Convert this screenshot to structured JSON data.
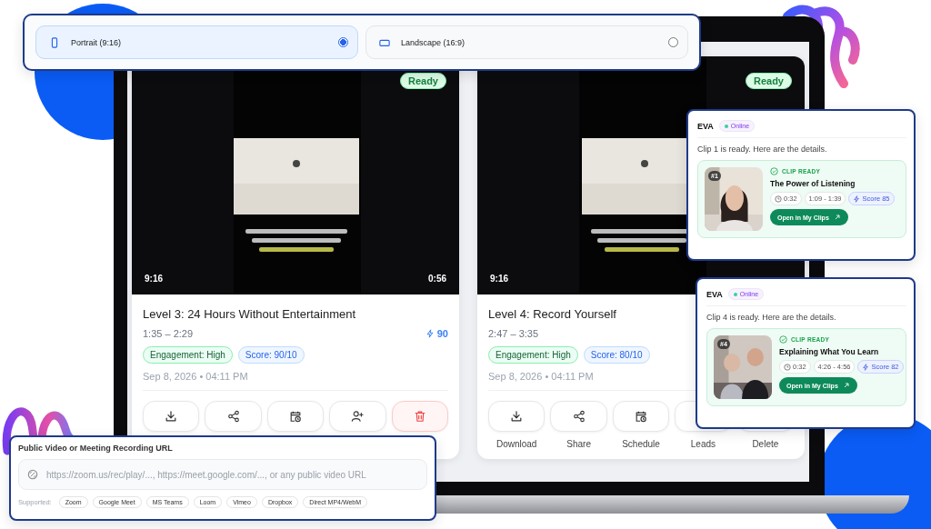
{
  "orientation_picker": {
    "options": [
      {
        "kind": "portrait",
        "label": "Portrait (9:16)",
        "selected": true
      },
      {
        "kind": "landscape",
        "label": "Landscape (16:9)",
        "selected": false
      }
    ]
  },
  "clips": [
    {
      "status": "Ready",
      "aspect": "9:16",
      "duration": "0:56",
      "title": "Level 3: 24 Hours Without Entertainment",
      "range": "1:35 – 2:29",
      "score": "90",
      "tags": [
        {
          "kind": "engagement",
          "label": "Engagement: High"
        },
        {
          "kind": "score",
          "label": "Score: 90/10"
        }
      ],
      "date": "Sep 8, 2026 • 04:11 PM",
      "actions": [
        {
          "kind": "download"
        },
        {
          "kind": "share"
        },
        {
          "kind": "schedule"
        },
        {
          "kind": "leads"
        },
        {
          "kind": "delete"
        }
      ]
    },
    {
      "status": "Ready",
      "aspect": "9:16",
      "title": "Level 4: Record Yourself",
      "range": "2:47 – 3:35",
      "tags": [
        {
          "kind": "engagement",
          "label": "Engagement: High"
        },
        {
          "kind": "score",
          "label": "Score: 80/10"
        }
      ],
      "date": "Sep 8, 2026 • 04:11 PM",
      "actions": [
        {
          "kind": "download",
          "label": "Download"
        },
        {
          "kind": "share",
          "label": "Share"
        },
        {
          "kind": "schedule",
          "label": "Schedule"
        },
        {
          "label": "Leads"
        },
        {
          "label": "Delete"
        }
      ]
    }
  ],
  "eva_messages": [
    {
      "name": "EVA",
      "status": "Online",
      "message": "Clip 1 is ready. Here are the details.",
      "clip": {
        "badge": "#1",
        "state": "CLIP READY",
        "title": "The Power of Listening",
        "duration": "0:32",
        "range": "1:09 - 1:39",
        "score": "Score 85",
        "button": "Open in My Clips"
      }
    },
    {
      "name": "EVA",
      "status": "Online",
      "message": "Clip 4 is ready. Here are the details.",
      "clip": {
        "badge": "#4",
        "state": "CLIP READY",
        "title": "Explaining What You Learn",
        "duration": "0:32",
        "range": "4:26 - 4:56",
        "score": "Score 82",
        "button": "Open in My Clips"
      }
    }
  ],
  "url_input": {
    "label": "Public Video or Meeting Recording URL",
    "placeholder": "https://zoom.us/rec/play/..., https://meet.google.com/..., or any public video URL",
    "supported_label": "Supported:",
    "platforms": [
      "Zoom",
      "Google Meet",
      "MS Teams",
      "Loom",
      "Vimeo",
      "Dropbox",
      "Direct MP4/WebM"
    ]
  }
}
